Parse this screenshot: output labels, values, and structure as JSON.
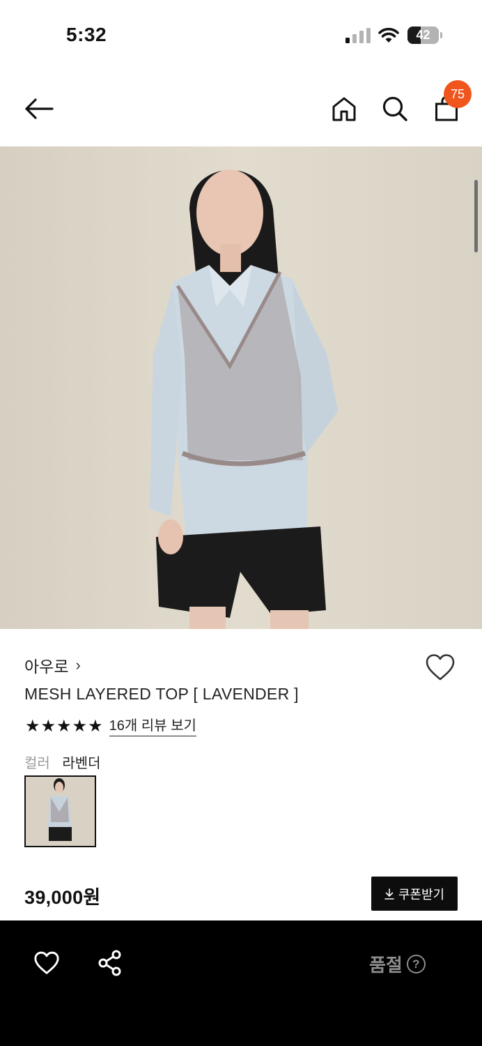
{
  "status_bar": {
    "time": "5:32",
    "battery_level": "42",
    "battery_fraction": 0.42
  },
  "header": {
    "back_icon": "arrow-left-icon",
    "home_icon": "home-icon",
    "search_icon": "search-icon",
    "bag_icon": "shopping-bag-icon",
    "cart_count": "75",
    "badge_color": "#f0551e"
  },
  "product": {
    "image_alt": "model wearing mesh layered top over light blue shirt",
    "brand": "아우로",
    "brand_chevron": "›",
    "title": "MESH LAYERED TOP [ LAVENDER ]",
    "rating_stars": 5,
    "review_link": "16개 리뷰 보기",
    "color_label": "컬러",
    "color_value": "라벤더",
    "price": "39,000원",
    "coupon_label": "쿠폰받기",
    "coupon_icon": "download-icon",
    "wish_icon": "heart-outline-icon"
  },
  "bottom_bar": {
    "wish_icon": "heart-outline-icon",
    "share_icon": "share-icon",
    "soldout_label": "품절",
    "help_icon": "question-circle-icon",
    "help_glyph": "?"
  }
}
